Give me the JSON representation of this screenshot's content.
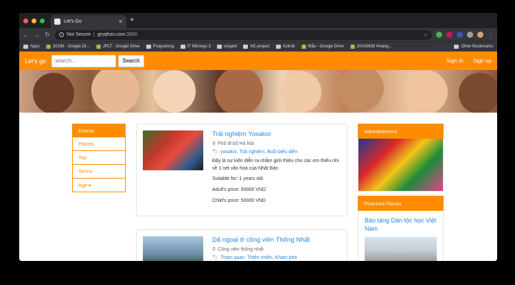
{
  "browser": {
    "tab_title": "Let's Go",
    "url_status": "Not Secure",
    "url_host": "gryqhon.com",
    "url_port": ":3000",
    "bookmarks": [
      "Apps",
      "2018II - Google Dr...",
      "JPLT - Google Drive",
      "Programing",
      "IT Nihongo 3",
      "origami",
      "KE-project",
      "Actindi",
      "Mẫu - Google Drive",
      "20143635 Hoàng..."
    ],
    "other_bookmarks": "Other Bookmarks"
  },
  "navbar": {
    "brand": "Let's go",
    "search_placeholder": "search...",
    "search_button": "Search",
    "sign_in": "Sign In",
    "sign_up": "Sign up"
  },
  "sidebar": {
    "items": [
      {
        "label": "Events"
      },
      {
        "label": "Places"
      },
      {
        "label": "Top"
      },
      {
        "label": "Terms"
      },
      {
        "label": "Age ▸"
      }
    ]
  },
  "events": [
    {
      "title": "Trải nghiệm Yosakoi",
      "location": "Phố đi bộ Hà Nội",
      "tags": "yosakoi, Trải nghiệm, Buổi biểu diễn",
      "description": "Đây là sự kiện diễn ra nhằm giới thiệu cho các em thiếu nhi về 1 nét văn hoá của Nhật Bản",
      "suitable": "Suitable for: 1 years old",
      "adult_price": "Adult's price: 50000 VND",
      "child_price": "Child's price: 50000 VND"
    },
    {
      "title": "Dã ngoại ở công viên Thống Nhất",
      "location": "Công viên thống nhất",
      "tags": "Tham quan, Thiên nhiên, Khám phá"
    }
  ],
  "right": {
    "ad_header": "Advertisement",
    "featured_header": "Featured Places",
    "featured_place": "Bảo tàng Dân tộc học Việt Nam"
  },
  "colors": {
    "accent": "#ff8c00",
    "link": "#1f8ae4"
  }
}
